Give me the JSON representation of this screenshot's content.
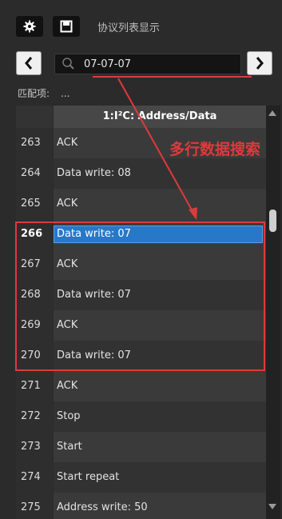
{
  "toolbar": {
    "title": "协议列表显示"
  },
  "search": {
    "value": "07-07-07"
  },
  "match": {
    "label": "匹配项:",
    "value": "..."
  },
  "table": {
    "header": "1:I²C: Address/Data",
    "rows": [
      {
        "num": "263",
        "value": "ACK"
      },
      {
        "num": "264",
        "value": "Data write: 08"
      },
      {
        "num": "265",
        "value": "ACK"
      },
      {
        "num": "266",
        "value": "Data write: 07"
      },
      {
        "num": "267",
        "value": "ACK"
      },
      {
        "num": "268",
        "value": "Data write: 07"
      },
      {
        "num": "269",
        "value": "ACK"
      },
      {
        "num": "270",
        "value": "Data write: 07"
      },
      {
        "num": "271",
        "value": "ACK"
      },
      {
        "num": "272",
        "value": "Stop"
      },
      {
        "num": "273",
        "value": "Start"
      },
      {
        "num": "274",
        "value": "Start repeat"
      },
      {
        "num": "275",
        "value": "Address write: 50"
      }
    ],
    "selected_row": "266"
  },
  "annotation": {
    "label": "多行数据搜索",
    "color": "#e0393b"
  },
  "colors": {
    "selection": "#2878c8",
    "background": "#2b2b2b"
  },
  "icons": [
    "gear-icon",
    "save-icon",
    "chevron-left-icon",
    "chevron-right-icon",
    "search-icon",
    "scroll-up-icon",
    "scroll-down-icon"
  ]
}
